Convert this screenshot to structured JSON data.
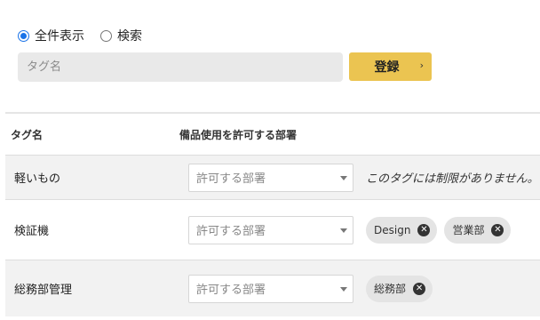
{
  "filter": {
    "all_label": "全件表示",
    "search_label": "検索",
    "selected": "all"
  },
  "form": {
    "tag_placeholder": "タグ名",
    "register_label": "登録",
    "register_arrow": "›"
  },
  "table": {
    "headers": [
      "タグ名",
      "備品使用を許可する部署"
    ],
    "rows": [
      {
        "name": "軽いもの",
        "select_placeholder": "許可する部署",
        "note": "このタグには制限がありません。",
        "chips": []
      },
      {
        "name": "検証機",
        "select_placeholder": "許可する部署",
        "note": "",
        "chips": [
          "Design",
          "営業部"
        ]
      },
      {
        "name": "総務部管理",
        "select_placeholder": "許可する部署",
        "note": "",
        "chips": [
          "総務部"
        ]
      }
    ]
  },
  "colors": {
    "accent": "#1a73e8",
    "button": "#ebc451",
    "row_shade": "#f2f2f2",
    "chip_bg": "#e4e4e4"
  },
  "icons": {
    "chip_remove": "close-circle-icon",
    "select_caret": "caret-down-icon"
  }
}
